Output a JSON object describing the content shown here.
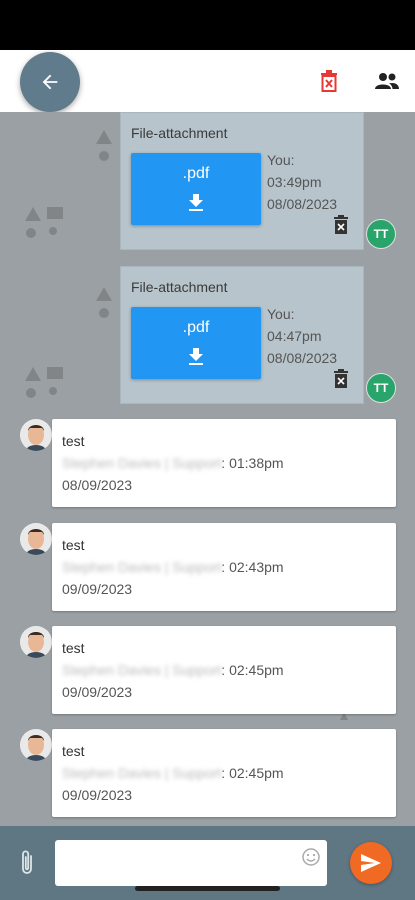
{
  "header": {
    "back_icon": "arrow-left-icon",
    "delete_icon": "delete-chat-icon",
    "participants_icon": "people-icon",
    "colors": {
      "back_bg": "#5f7b8c",
      "delete": "#e53935",
      "header_bg": "#ffffff"
    }
  },
  "attachments": [
    {
      "title": "File-attachment",
      "file_label": ".pdf",
      "sender": "You:",
      "time": "03:49pm",
      "date": "08/08/2023",
      "avatar": "TT"
    },
    {
      "title": "File-attachment",
      "file_label": ".pdf",
      "sender": "You:",
      "time": "04:47pm",
      "date": "08/08/2023",
      "avatar": "TT"
    }
  ],
  "messages": [
    {
      "text": "test",
      "sender": "Stephen Davies | Support",
      "time": ": 01:38pm",
      "date": "08/09/2023"
    },
    {
      "text": "test",
      "sender": "Stephen Davies | Support",
      "time": ": 02:43pm",
      "date": "09/09/2023"
    },
    {
      "text": "test",
      "sender": "Stephen Davies | Support",
      "time": ": 02:45pm",
      "date": "09/09/2023"
    },
    {
      "text": "test",
      "sender": "Stephen Davies | Support",
      "time": ": 02:45pm",
      "date": "09/09/2023"
    }
  ],
  "composer": {
    "placeholder": "",
    "attach_icon": "paperclip-icon",
    "emoji_icon": "emoji-icon",
    "send_icon": "send-icon",
    "colors": {
      "send": "#f06a24",
      "bar": "#5f7683"
    }
  },
  "colors": {
    "chat_bg": "#9aa0a4",
    "attachment_bg": "#b7c4cc",
    "pdf_button": "#2196f3",
    "tt_avatar": "#29a56c"
  }
}
